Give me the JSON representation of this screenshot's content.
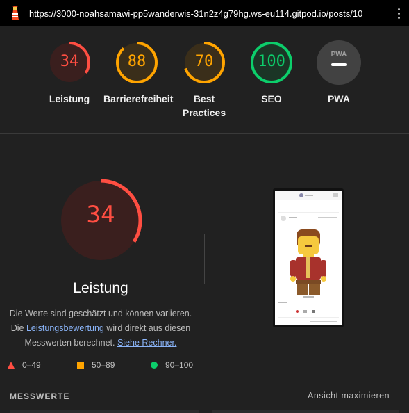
{
  "browser": {
    "url": "https://3000-noahsamawi-pp5wanderwis-31n2z4g79hg.ws-eu114.gitpod.io/posts/10",
    "icon": "lighthouse-icon",
    "menu_icon": "kebab-menu-icon"
  },
  "scores": [
    {
      "label": "Leistung",
      "value": "34",
      "fraction": 0.34,
      "color": "#ff4e42",
      "bg": "#3a1f1e"
    },
    {
      "label": "Barrierefreiheit",
      "value": "88",
      "fraction": 0.88,
      "color": "#ffa400",
      "bg": "#3a2e1a"
    },
    {
      "label": "Best Practices",
      "value": "70",
      "fraction": 0.7,
      "color": "#ffa400",
      "bg": "#3a2e1a"
    },
    {
      "label": "SEO",
      "value": "100",
      "fraction": 1.0,
      "color": "#0cce6b",
      "bg": "#1b3526"
    },
    {
      "label": "PWA",
      "value": "PWA",
      "fraction": 0,
      "color": "#e0e0e0",
      "bg": "#424242"
    }
  ],
  "performance": {
    "score": "34",
    "fraction": 0.34,
    "title": "Leistung",
    "desc_line1": "Die Werte sind geschätzt und können variieren.",
    "desc_pre": "Die ",
    "desc_link1": "Leistungsbewertung",
    "desc_mid": " wird direkt aus diesen",
    "desc_line3_pre": "Messwerten berechnet. ",
    "desc_link2": "Siehe Rechner."
  },
  "legend": [
    {
      "label": "0–49",
      "shape": "triangle",
      "color": "#ff4e42"
    },
    {
      "label": "50–89",
      "shape": "square",
      "color": "#ffa400"
    },
    {
      "label": "90–100",
      "shape": "circle",
      "color": "#0cce6b"
    }
  ],
  "metrics": {
    "header": "MESSWERTE",
    "expand_label": "Ansicht maximieren"
  },
  "screenshot": {
    "post_user": "johnny",
    "post_time": "4 days, 7 hours ago",
    "caption": "johnny10",
    "footer_text": "Wanderwise"
  }
}
